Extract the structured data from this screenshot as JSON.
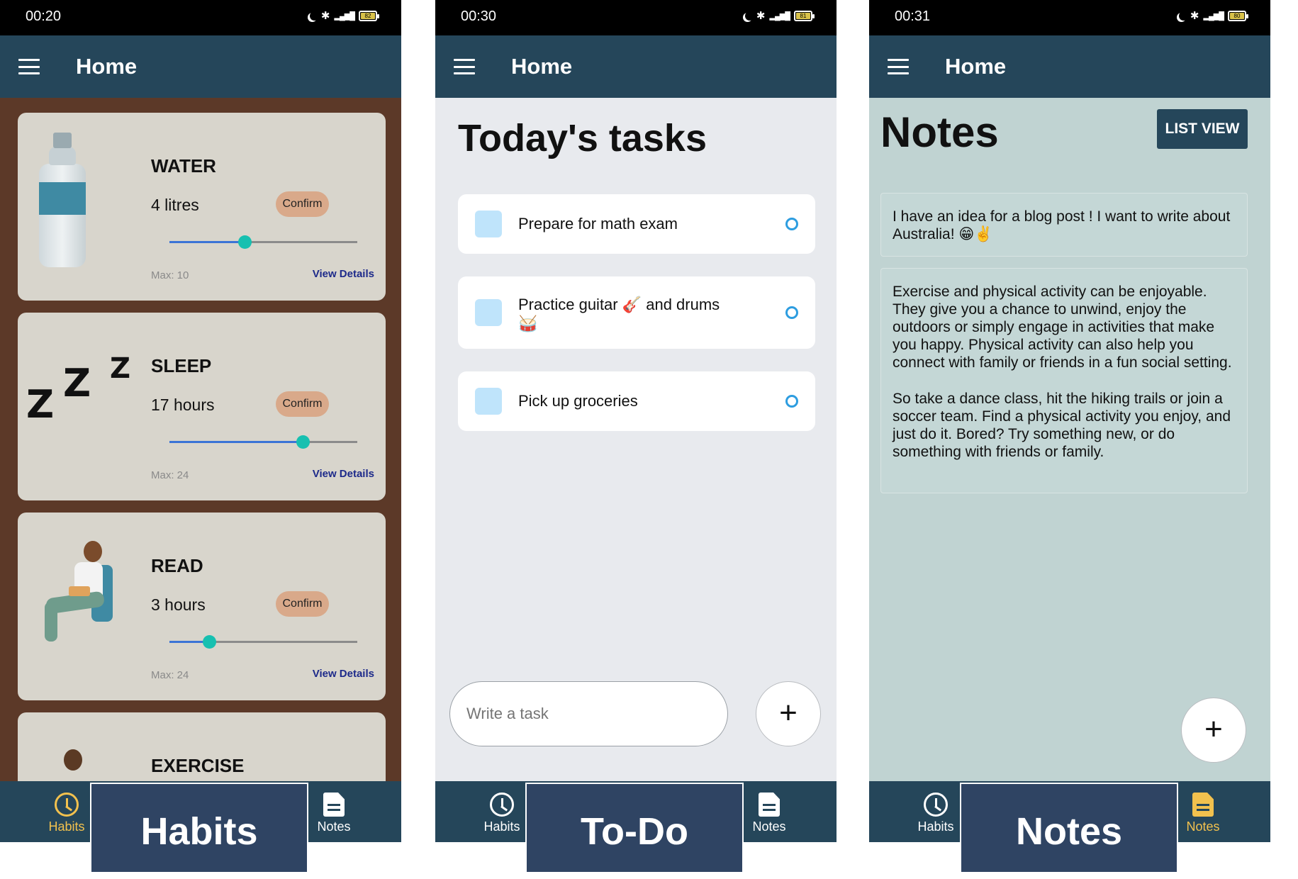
{
  "screens": [
    {
      "status_time": "00:20",
      "battery": "82",
      "app_title": "Home",
      "caption": "Habits",
      "nav": [
        {
          "label": "Habits",
          "icon": "clock-icon",
          "active": true
        },
        {
          "label": "Notes",
          "icon": "document-icon",
          "active": false
        }
      ]
    },
    {
      "status_time": "00:30",
      "battery": "81",
      "app_title": "Home",
      "caption": "To-Do",
      "nav": [
        {
          "label": "Habits",
          "icon": "clock-icon",
          "active": false
        },
        {
          "label": "Notes",
          "icon": "document-icon",
          "active": false
        }
      ]
    },
    {
      "status_time": "00:31",
      "battery": "80",
      "app_title": "Home",
      "caption": "Notes",
      "nav": [
        {
          "label": "Habits",
          "icon": "clock-icon",
          "active": false
        },
        {
          "label": "Notes",
          "icon": "document-icon",
          "active": true
        }
      ]
    }
  ],
  "habits": [
    {
      "name": "WATER",
      "value": "4 litres",
      "confirm": "Confirm",
      "max": "Max: 10",
      "details": "View Details",
      "level": 0.4,
      "image": "water-bottle"
    },
    {
      "name": "SLEEP",
      "value": "17 hours",
      "confirm": "Confirm",
      "max": "Max: 24",
      "details": "View Details",
      "level": 0.71,
      "image": "sleep-zzz"
    },
    {
      "name": "READ",
      "value": "3 hours",
      "confirm": "Confirm",
      "max": "Max: 24",
      "details": "View Details",
      "level": 0.21,
      "image": "person-reading"
    },
    {
      "name": "EXERCISE",
      "image": "person-exercising"
    }
  ],
  "todo": {
    "title": "Today's tasks",
    "tasks": [
      {
        "text": "Prepare for math exam"
      },
      {
        "text": "Practice guitar 🎸 and drums 🥁"
      },
      {
        "text": "Pick up groceries"
      }
    ],
    "input_placeholder": "Write a task",
    "add_label": "+"
  },
  "notes": {
    "title": "Notes",
    "list_view_label": "LIST VIEW",
    "items": [
      {
        "paragraphs": [
          "I have an idea for a blog post ! I want to write about Australia! 😁✌️"
        ]
      },
      {
        "paragraphs": [
          "Exercise and physical activity can be enjoyable. They give you a chance to unwind, enjoy the outdoors or simply engage in activities that make you happy. Physical activity can also help you connect with family or friends in a fun social setting.",
          "So take a dance class, hit the hiking trails or join a soccer team. Find a physical activity you enjoy, and just do it. Bored? Try something new, or do something with friends or family."
        ]
      }
    ],
    "add_label": "+"
  },
  "colors": {
    "appbar": "#25465a",
    "habits_background": "#5c3928",
    "habit_card": "#d8d5cc",
    "confirm": "#d9a98a",
    "slider_thumb": "#17c0b0",
    "slider_track": "#3b74d6",
    "nav_active": "#f2c14e",
    "caption": "#2f4463",
    "todo_background": "#e8eaee",
    "task_checkbox": "#bfe4fb",
    "notes_background": "#c0d3d2"
  }
}
